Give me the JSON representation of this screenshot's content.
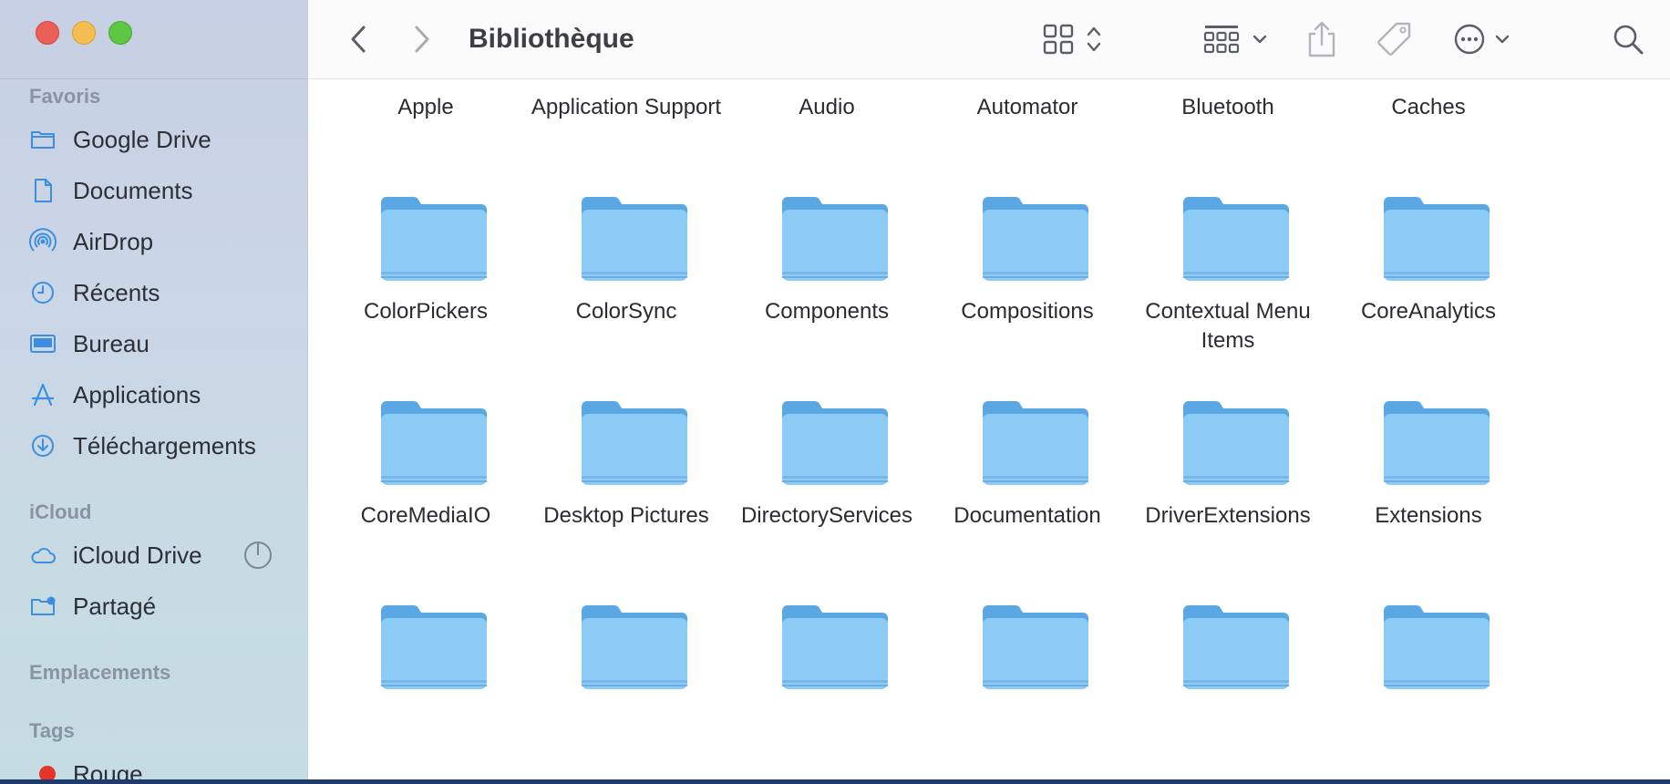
{
  "window": {
    "title": "Bibliothèque"
  },
  "sidebar": {
    "sections": {
      "favoris": "Favoris",
      "icloud": "iCloud",
      "emplacements": "Emplacements",
      "tags": "Tags"
    },
    "favoris": [
      {
        "label": "Google Drive",
        "icon": "folder-icon"
      },
      {
        "label": "Documents",
        "icon": "document-icon"
      },
      {
        "label": "AirDrop",
        "icon": "airdrop-icon"
      },
      {
        "label": "Récents",
        "icon": "clock-icon"
      },
      {
        "label": "Bureau",
        "icon": "desktop-icon"
      },
      {
        "label": "Applications",
        "icon": "applications-icon"
      },
      {
        "label": "Téléchargements",
        "icon": "download-icon"
      }
    ],
    "icloud": [
      {
        "label": "iCloud Drive",
        "icon": "cloud-icon"
      },
      {
        "label": "Partagé",
        "icon": "shared-folder-icon"
      }
    ],
    "tags": [
      {
        "label": "Rouge",
        "color": "#e5352b"
      }
    ]
  },
  "folders": [
    [
      "Apple",
      "Application Support",
      "Audio",
      "Automator",
      "Bluetooth",
      "Caches"
    ],
    [
      "ColorPickers",
      "ColorSync",
      "Components",
      "Compositions",
      "Contextual Menu Items",
      "CoreAnalytics"
    ],
    [
      "CoreMediaIO",
      "Desktop Pictures",
      "DirectoryServices",
      "Documentation",
      "DriverExtensions",
      "Extensions"
    ],
    [
      "",
      "",
      "",
      "",
      "",
      ""
    ]
  ],
  "colors": {
    "folder": "#8ccbf5",
    "folder_tab": "#5aa7e4",
    "accent": "#3b8ee0"
  }
}
